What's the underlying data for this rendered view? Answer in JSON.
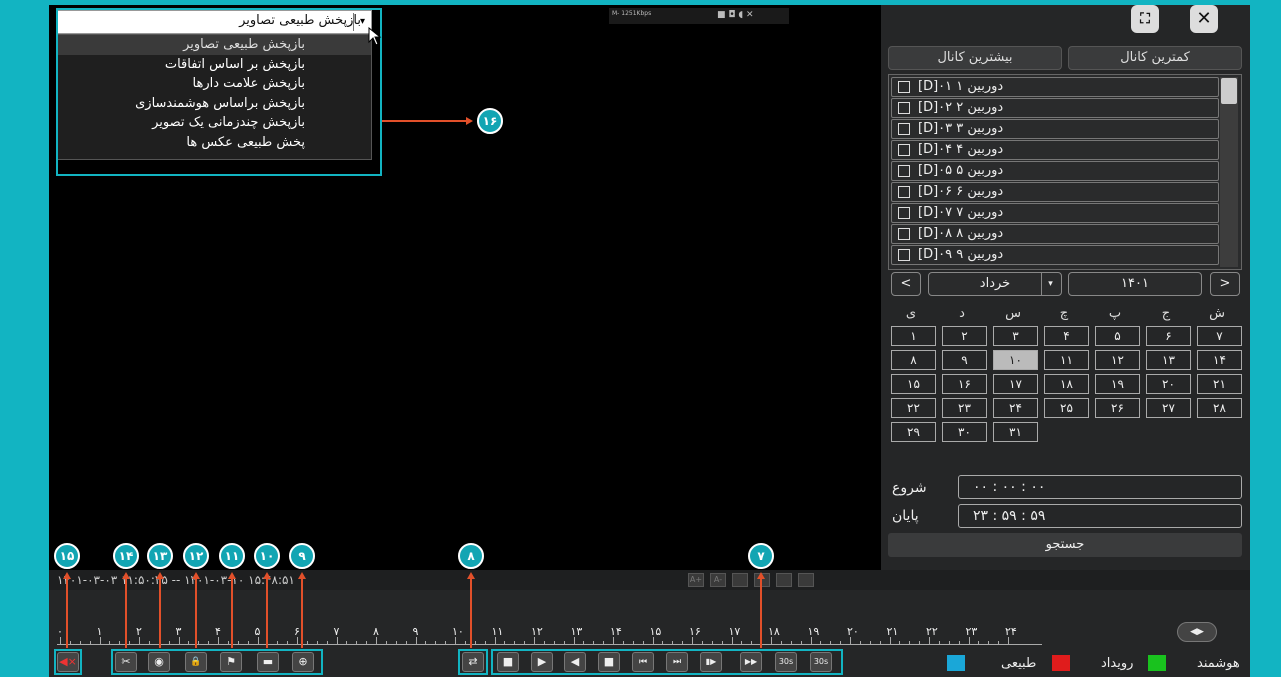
{
  "topbar": {
    "bitrate": "M- 1251Kbps",
    "icons": "■ ◘ ◖ ✕"
  },
  "window": {
    "close": "✕",
    "fullscreen": "⛶"
  },
  "dropdown": {
    "selected": "بازپخش طبیعی تصاویر",
    "arrow": "▾",
    "options": [
      "بازپخش طبیعی تصاویر",
      "بازپخش بر اساس اتفاقات",
      "بازپخش علامت دارها",
      "بازپخش براساس هوشمندسازی",
      "بازپخش چندزمانی یک تصویر",
      "پخش طبیعی عکس ها"
    ]
  },
  "panel": {
    "min_channel": "کمترین کانال",
    "max_channel": "بیشترین کانال",
    "channels": [
      "[D]۰۱ دوربین ۱",
      "[D]۰۲ دوربین ۲",
      "[D]۰۳ دوربین ۳",
      "[D]۰۴ دوربین ۴",
      "[D]۰۵ دوربین ۵",
      "[D]۰۶ دوربین ۶",
      "[D]۰۷ دوربین ۷",
      "[D]۰۸ دوربین ۸",
      "[D]۰۹ دوربین ۹"
    ],
    "prev": "<",
    "next": ">",
    "month": "خرداد",
    "year": "۱۴۰۱",
    "weekdays": [
      "ش",
      "ی",
      "د",
      "س",
      "چ",
      "پ",
      "ج"
    ],
    "days": [
      "۱",
      "۲",
      "۳",
      "۴",
      "۵",
      "۶",
      "۷",
      "۸",
      "۹",
      "۱۰",
      "۱۱",
      "۱۲",
      "۱۳",
      "۱۴",
      "۱۵",
      "۱۶",
      "۱۷",
      "۱۸",
      "۱۹",
      "۲۰",
      "۲۱",
      "۲۲",
      "۲۳",
      "۲۴",
      "۲۵",
      "۲۶",
      "۲۷",
      "۲۸",
      "۲۹",
      "۳۰",
      "۳۱"
    ],
    "selected_day": "۱۰",
    "start_label": "شروع",
    "end_label": "پایان",
    "start_time": "۰۰ : ۰۰ : ۰۰",
    "end_time": "۲۳ : ۵۹ : ۵۹",
    "search": "جستجو"
  },
  "timeline": {
    "range_text": "۱۴۰۱-۰۳-۰۳ ۱۱:۵۰:۴۵ -- ۱۴۰۱-۰۳-۱۰ ۱۵:۴۸:۵۱",
    "hours": [
      "۰",
      "۱",
      "۲",
      "۳",
      "۴",
      "۵",
      "۶",
      "۷",
      "۸",
      "۹",
      "۱۰",
      "۱۱",
      "۱۲",
      "۱۳",
      "۱۴",
      "۱۵",
      "۱۶",
      "۱۷",
      "۱۸",
      "۱۹",
      "۲۰",
      "۲۱",
      "۲۲",
      "۲۳",
      "۲۴"
    ]
  },
  "markers": [
    "۱۵",
    "۱۴",
    "۱۳",
    "۱۲",
    "۱۱",
    "۱۰",
    "۹",
    "۸",
    "۷",
    "۱۶"
  ],
  "legend": {
    "smart": "هوشمند",
    "event": "رویداد",
    "normal": "طبیعی",
    "smart_color": "#19c21e",
    "event_color": "#e01c1c",
    "normal_color": "#1aa7d8"
  },
  "controls": {
    "mute": "◀×",
    "cut": "✂",
    "snapshot": "◉",
    "lock": "🔒",
    "tag": "⚑",
    "folder": "▬",
    "zoom": "⊕",
    "sync": "⇄",
    "stop_all": "■",
    "play": "▶",
    "reverse": "◀",
    "stop": "■",
    "prev": "⏮",
    "next": "⏭",
    "step": "▮▶",
    "fast": "▶▶",
    "back30": "30s",
    "fwd30": "30s",
    "nav": "◀▶"
  }
}
